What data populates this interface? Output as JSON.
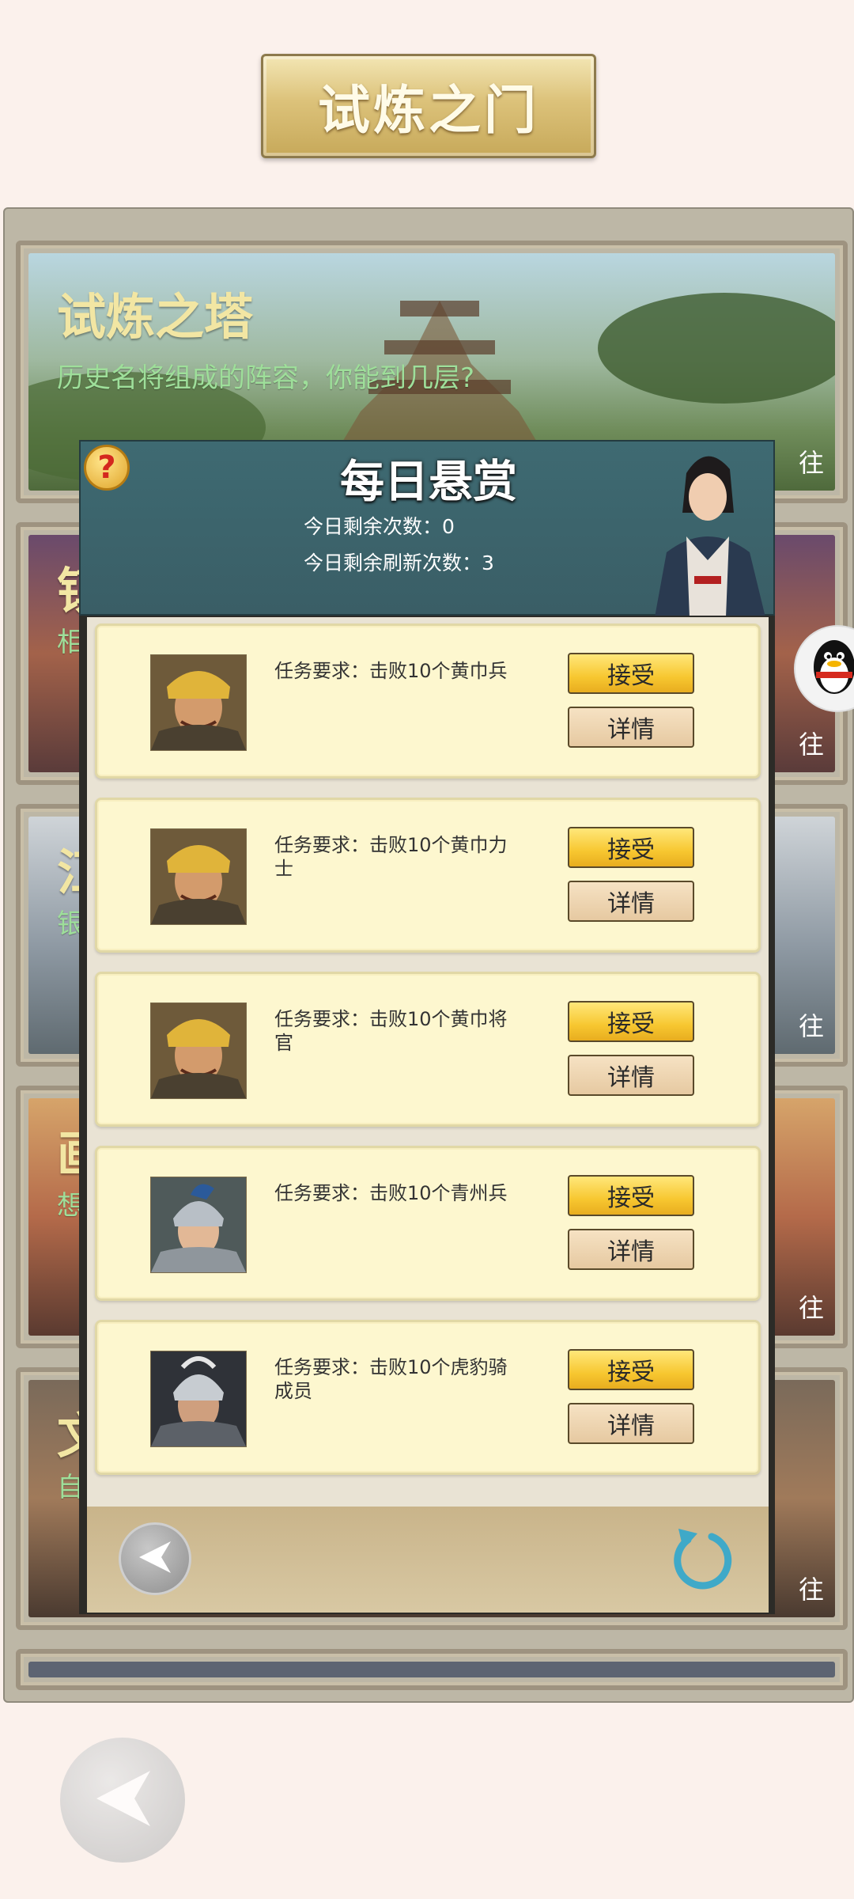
{
  "page": {
    "title": "试炼之门"
  },
  "cards": [
    {
      "title": "试炼之塔",
      "subtitle": "历史名将组成的阵容，你能到几层?",
      "go": "往"
    },
    {
      "title": "镇",
      "subtitle": "相",
      "go": "往"
    },
    {
      "title": "江",
      "subtitle": "银",
      "go": "往"
    },
    {
      "title": "画",
      "subtitle": "想",
      "go": "往"
    },
    {
      "title": "文",
      "subtitle": "自",
      "go": "往"
    }
  ],
  "dialog": {
    "title": "每日悬赏",
    "help_symbol": "?",
    "remaining_label": "今日剩余次数：0",
    "refresh_label": "今日剩余刷新次数：3",
    "tasks": [
      {
        "requirement": "任务要求：击败10个黄巾兵",
        "accept": "接受",
        "detail": "详情",
        "avatar": "yellow-turban-soldier"
      },
      {
        "requirement": "任务要求：击败10个黄巾力士",
        "accept": "接受",
        "detail": "详情",
        "avatar": "yellow-turban-soldier"
      },
      {
        "requirement": "任务要求：击败10个黄巾将官",
        "accept": "接受",
        "detail": "详情",
        "avatar": "yellow-turban-soldier"
      },
      {
        "requirement": "任务要求：击败10个青州兵",
        "accept": "接受",
        "detail": "详情",
        "avatar": "qingzhou-soldier"
      },
      {
        "requirement": "任务要求：击败10个虎豹骑成员",
        "accept": "接受",
        "detail": "详情",
        "avatar": "tiger-leopard-cavalry"
      }
    ]
  },
  "colors": {
    "accent_gold": "#f7c730",
    "header_teal": "#3e6a72",
    "card_title": "#f2e6a3",
    "card_subtitle": "#9edf9a"
  }
}
